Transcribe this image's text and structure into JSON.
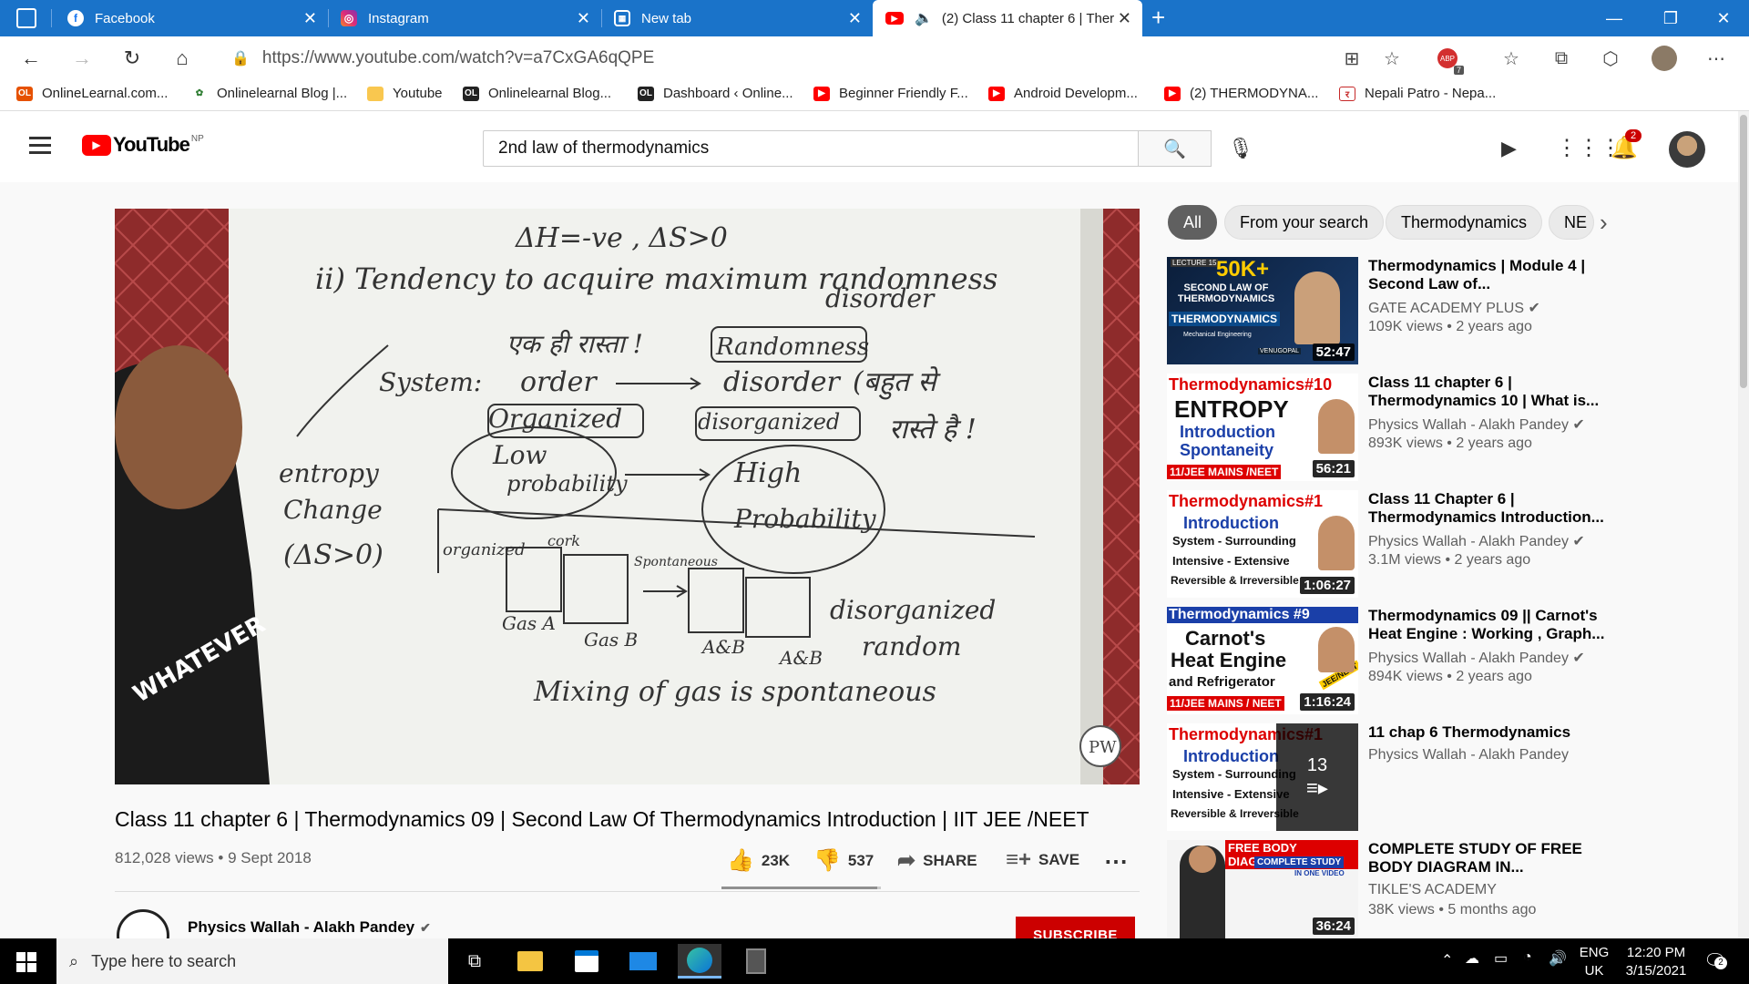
{
  "browser": {
    "tabs": [
      {
        "label": "Facebook",
        "icon": "facebook-icon"
      },
      {
        "label": "Instagram",
        "icon": "instagram-icon"
      },
      {
        "label": "New tab",
        "icon": "newtab-icon"
      },
      {
        "label": "(2) Class 11 chapter 6 | Ther",
        "icon": "youtube-icon"
      }
    ],
    "url": "https://www.youtube.com/watch?v=a7CxGA6qQPE",
    "bookmarks": [
      {
        "label": "OnlineLearnal.com..."
      },
      {
        "label": "Onlinelearnal Blog |..."
      },
      {
        "label": "Youtube"
      },
      {
        "label": "Onlinelearnal Blog..."
      },
      {
        "label": "Dashboard ‹ Online..."
      },
      {
        "label": "Beginner Friendly F..."
      },
      {
        "label": "Android Developm..."
      },
      {
        "label": "(2) THERMODYNA..."
      },
      {
        "label": "Nepali Patro - Nepa..."
      }
    ],
    "extension_badge": "7"
  },
  "youtube": {
    "logo_text": "YouTube",
    "region": "NP",
    "search_value": "2nd law of thermodynamics",
    "notification_count": "2",
    "video": {
      "title": "Class 11 chapter 6 | Thermodynamics 09 | Second Law Of Thermodynamics Introduction | IIT JEE /NEET",
      "views": "812,028 views",
      "date": "9 Sept 2018",
      "likes": "23K",
      "dislikes": "537",
      "share_label": "SHARE",
      "save_label": "SAVE",
      "like_ratio": 0.977,
      "board": {
        "line1": "ΔH=-ve , ΔS>0",
        "line2": "ii) Tendency to acquire maximum randomness",
        "line3": "disorder",
        "hindi1": "एक ही रास्ता !",
        "randomness": "Randomness",
        "system": "System:",
        "order": "order",
        "disorder": "disorder",
        "hindi2": "(बहुत से",
        "hindi3": "रास्ते है !",
        "organized": "Organized",
        "disorganized": "disorganized",
        "low": "Low",
        "probability": "probability",
        "high": "High",
        "Probability": "Probability",
        "entropy": "entropy",
        "change": "Change",
        "ds": "(ΔS>0)",
        "organized_small": "organized",
        "cork": "cork",
        "spontaneous_small": "Spontaneous",
        "gas_a": "Gas A",
        "gas_b": "Gas B",
        "a_b1": "A&B",
        "a_b2": "A&B",
        "disorganized2": "disorganized",
        "random": "random",
        "mixing": "Mixing of gas is spontaneous",
        "shirt": "WHATEVER",
        "pw": "PW"
      }
    },
    "channel": {
      "name": "Physics Wallah - Alakh Pandey",
      "subscribe_label": "SUBSCRIBE"
    },
    "chips": [
      "All",
      "From your search",
      "Thermodynamics",
      "NE"
    ],
    "recommendations": [
      {
        "title": "Thermodynamics | Module 4 | Second Law of...",
        "channel": "GATE ACADEMY PLUS",
        "meta": "109K views • 2 years ago",
        "duration": "52:47",
        "thumb_lines": [
          "LECTURE 15",
          "50K+",
          "SECOND LAW OF THERMODYNAMICS",
          "THERMODYNAMICS",
          "Mechanical Engineering",
          "VENUGOPAL"
        ]
      },
      {
        "title": "Class 11 chapter 6 | Thermodynamics 10 | What is...",
        "channel": "Physics Wallah - Alakh Pandey",
        "meta": "893K views • 2 years ago",
        "duration": "56:21",
        "thumb_lines": [
          "Thermodynamics#10",
          "ENTROPY",
          "Introduction",
          "Spontaneity",
          "11/JEE MAINS /NEET"
        ]
      },
      {
        "title": "Class 11 Chapter 6 | Thermodynamics Introduction...",
        "channel": "Physics Wallah - Alakh Pandey",
        "meta": "3.1M views • 2 years ago",
        "duration": "1:06:27",
        "thumb_lines": [
          "Thermodynamics#1",
          "Introduction",
          "System - Surrounding",
          "Intensive - Extensive",
          "Reversible & Irreversible"
        ]
      },
      {
        "title": "Thermodynamics 09 || Carnot's Heat Engine : Working , Graph...",
        "channel": "Physics Wallah - Alakh Pandey",
        "meta": "894K views • 2 years ago",
        "duration": "1:16:24",
        "thumb_lines": [
          "Thermodynamics #9",
          "Carnot's",
          "Heat Engine",
          "and Refrigerator",
          "11/JEE MAINS / NEET",
          "JEE/NEET"
        ]
      },
      {
        "title": "11 chap 6 Thermodynamics",
        "channel": "Physics Wallah - Alakh Pandey",
        "meta": "",
        "duration": "",
        "playlist_count": "13",
        "thumb_lines": [
          "Thermodynamics#1",
          "Introduction",
          "System - Surrounding",
          "Intensive - Extensive",
          "Reversible & Irreversible"
        ]
      },
      {
        "title": "COMPLETE STUDY OF FREE BODY DIAGRAM IN...",
        "channel": "TIKLE'S ACADEMY",
        "meta": "38K views • 5 months ago",
        "duration": "36:24",
        "thumb_lines": [
          "FREE BODY DIAGRAM",
          "COMPLETE STUDY",
          "IN ONE VIDEO"
        ]
      }
    ]
  },
  "taskbar": {
    "search_placeholder": "Type here to search",
    "lang1": "ENG",
    "lang2": "UK",
    "time": "12:20 PM",
    "date": "3/15/2021",
    "notif_count": "2"
  },
  "colors": {
    "titlebar": "#1a73c9",
    "youtube_red": "#ff0000",
    "subscribe": "#cc0000"
  }
}
